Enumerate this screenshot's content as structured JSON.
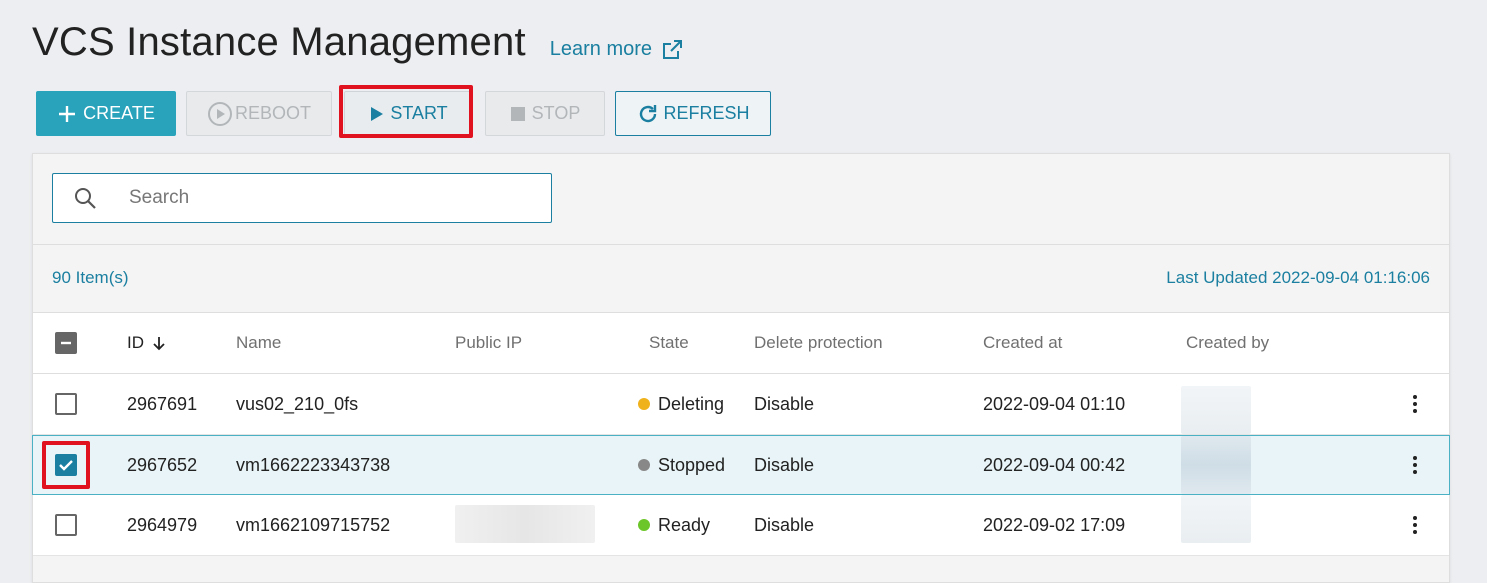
{
  "page": {
    "title": "VCS Instance Management",
    "learn_more": "Learn more"
  },
  "toolbar": {
    "create": "CREATE",
    "reboot": "REBOOT",
    "start": "START",
    "stop": "STOP",
    "refresh": "REFRESH"
  },
  "search": {
    "placeholder": "Search",
    "value": ""
  },
  "summary": {
    "items": "90 Item(s)",
    "last_updated": "Last Updated 2022-09-04 01:16:06"
  },
  "table": {
    "headers": {
      "id": "ID",
      "name": "Name",
      "public_ip": "Public IP",
      "state": "State",
      "delete_protection": "Delete protection",
      "created_at": "Created at",
      "created_by": "Created by"
    },
    "rows": [
      {
        "id": "2967691",
        "name": "vus02_210_0fs",
        "state": "Deleting",
        "state_color": "#f0b21c",
        "delete_protection": "Disable",
        "created_at": "2022-09-04 01:10",
        "selected": false
      },
      {
        "id": "2967652",
        "name": "vm1662223343738",
        "state": "Stopped",
        "state_color": "#888888",
        "delete_protection": "Disable",
        "created_at": "2022-09-04 00:42",
        "selected": true
      },
      {
        "id": "2964979",
        "name": "vm1662109715752",
        "state": "Ready",
        "state_color": "#6cc62a",
        "delete_protection": "Disable",
        "created_at": "2022-09-02 17:09",
        "selected": false
      }
    ]
  },
  "colors": {
    "accent": "#28a3bb",
    "link": "#1a7fa0",
    "highlight": "#e0121f"
  }
}
